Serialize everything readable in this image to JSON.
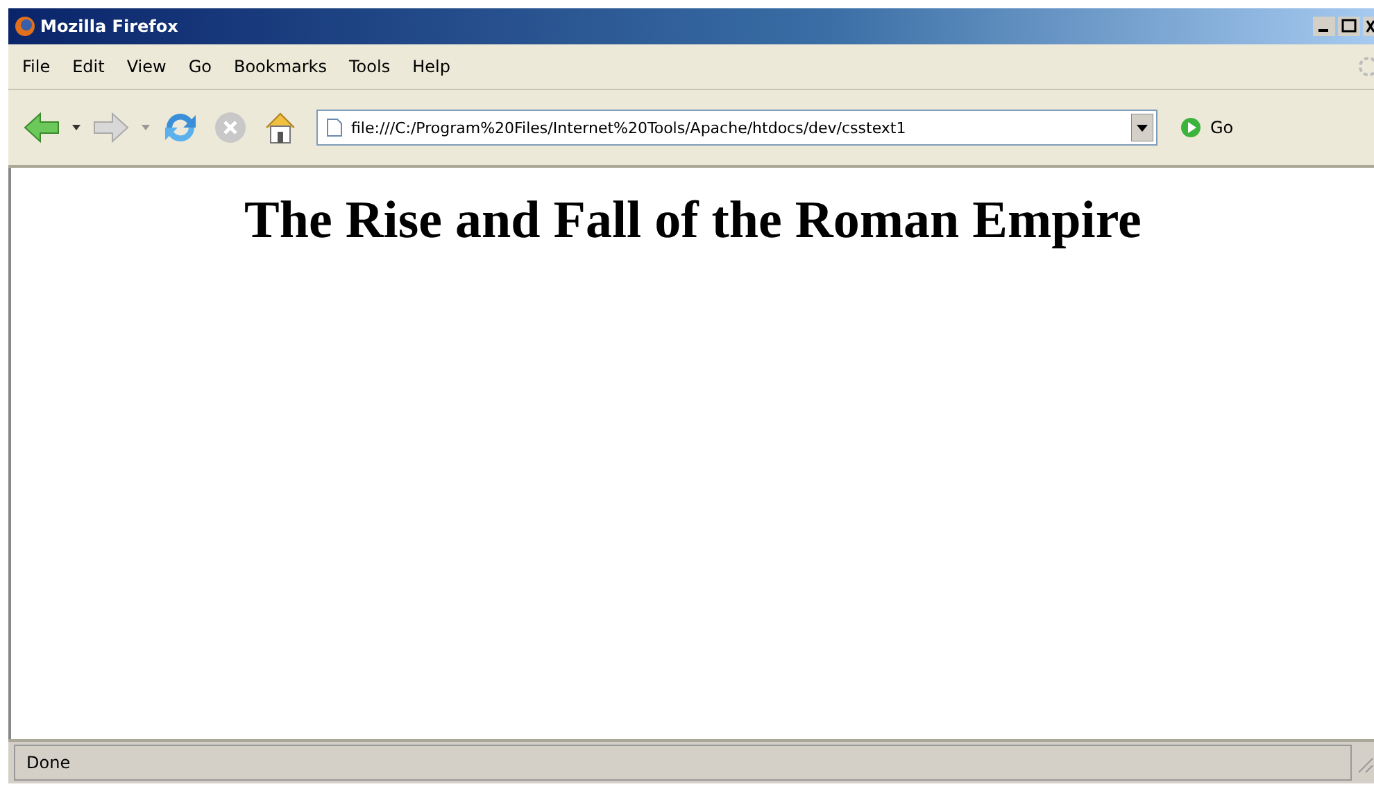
{
  "window": {
    "title": "Mozilla Firefox"
  },
  "menu": [
    "File",
    "Edit",
    "View",
    "Go",
    "Bookmarks",
    "Tools",
    "Help"
  ],
  "address": {
    "value": "file:///C:/Program%20Files/Internet%20Tools/Apache/htdocs/dev/csstext1"
  },
  "go_button": {
    "label": "Go"
  },
  "page": {
    "heading": "The Rise and Fall of the Roman Empire"
  },
  "status_bar": {
    "text": "Done"
  }
}
